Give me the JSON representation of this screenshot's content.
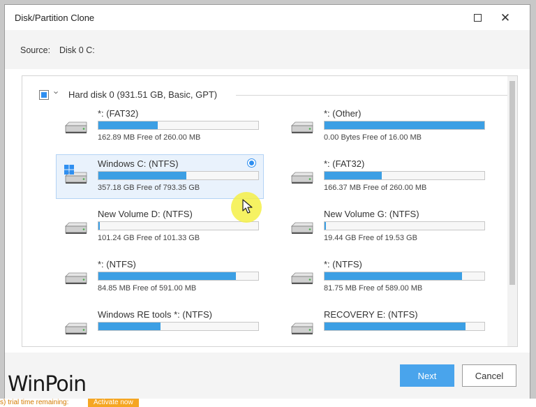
{
  "window": {
    "title": "Disk/Partition Clone"
  },
  "source": {
    "label": "Source:",
    "value": "Disk 0 C:"
  },
  "disk": {
    "title": "Hard disk 0 (931.51 GB, Basic, GPT)",
    "checked": true
  },
  "partitions": [
    {
      "name": "*: (FAT32)",
      "free": "162.89 MB Free of 260.00 MB",
      "used_fraction": 0.37,
      "selected": false
    },
    {
      "name": "*: (Other)",
      "free": "0.00 Bytes Free of 16.00 MB",
      "used_fraction": 1.0,
      "selected": false
    },
    {
      "name": "Windows C: (NTFS)",
      "free": "357.18 GB Free of 793.35 GB",
      "used_fraction": 0.55,
      "selected": true,
      "icon": "windows-icon"
    },
    {
      "name": "*: (FAT32)",
      "free": "166.37 MB Free of 260.00 MB",
      "used_fraction": 0.36,
      "selected": false
    },
    {
      "name": "New Volume D: (NTFS)",
      "free": "101.24 GB Free of 101.33 GB",
      "used_fraction": 0.01,
      "selected": false
    },
    {
      "name": "New Volume G: (NTFS)",
      "free": "19.44 GB Free of 19.53 GB",
      "used_fraction": 0.01,
      "selected": false
    },
    {
      "name": "*: (NTFS)",
      "free": "84.85 MB Free of 591.00 MB",
      "used_fraction": 0.86,
      "selected": false
    },
    {
      "name": "*: (NTFS)",
      "free": "81.75 MB Free of 589.00 MB",
      "used_fraction": 0.86,
      "selected": false
    },
    {
      "name": "Windows RE tools *: (NTFS)",
      "free": "",
      "used_fraction": 0.39,
      "selected": false
    },
    {
      "name": "RECOVERY E: (NTFS)",
      "free": "",
      "used_fraction": 0.88,
      "selected": false
    }
  ],
  "footer": {
    "next_label": "Next",
    "cancel_label": "Cancel"
  },
  "watermark": "WinPoin",
  "trial": {
    "text": "s) trial time remaining:",
    "activate_label": "Activate now"
  },
  "colors": {
    "accent": "#2f8ff0",
    "bar_fill": "#3c9fe4",
    "next_button": "#49a4ec",
    "selected_bg": "#e9f2fc",
    "cursor_highlight": "#f5f046",
    "trial_orange": "#f5a623"
  }
}
